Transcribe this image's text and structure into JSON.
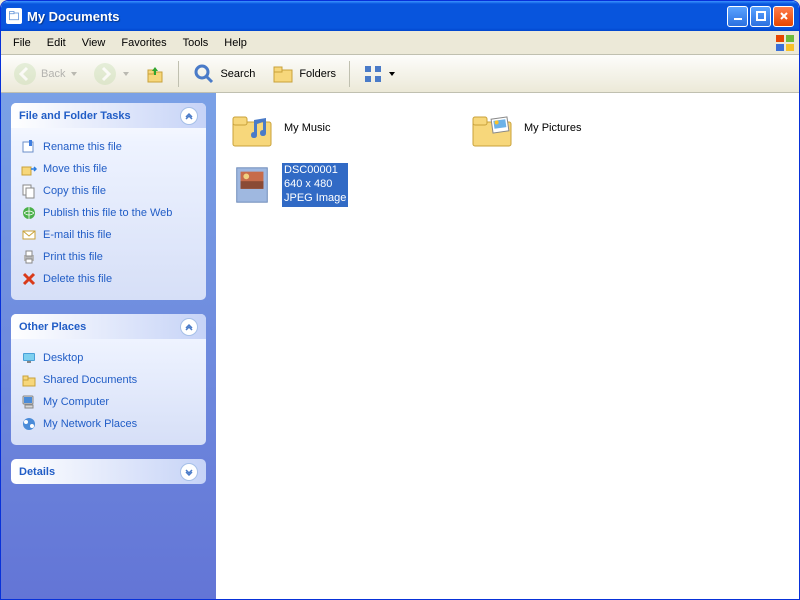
{
  "window": {
    "title": "My Documents"
  },
  "menu": {
    "file": "File",
    "edit": "Edit",
    "view": "View",
    "favorites": "Favorites",
    "tools": "Tools",
    "help": "Help"
  },
  "toolbar": {
    "back": "Back",
    "search": "Search",
    "folders": "Folders"
  },
  "sidebar": {
    "tasks": {
      "title": "File and Folder Tasks",
      "rename": "Rename this file",
      "move": "Move this file",
      "copy": "Copy this file",
      "publish": "Publish this file to the Web",
      "email": "E-mail this file",
      "print": "Print this file",
      "delete": "Delete this file"
    },
    "places": {
      "title": "Other Places",
      "desktop": "Desktop",
      "shared": "Shared Documents",
      "mycomputer": "My Computer",
      "network": "My Network Places"
    },
    "details": {
      "title": "Details"
    }
  },
  "content": {
    "items": {
      "music": {
        "name": "My Music"
      },
      "pictures": {
        "name": "My Pictures"
      },
      "selected": {
        "name": "DSC00001",
        "dimensions": "640 x 480",
        "type": "JPEG Image"
      }
    }
  }
}
